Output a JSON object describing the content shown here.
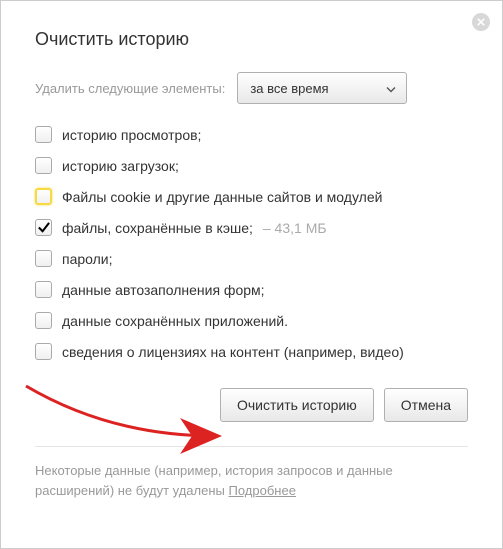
{
  "title": "Очистить историю",
  "time_range": {
    "label": "Удалить следующие элементы:",
    "selected": "за все время"
  },
  "options": [
    {
      "label": "историю просмотров;",
      "checked": false,
      "highlight": false,
      "extra": ""
    },
    {
      "label": "историю загрузок;",
      "checked": false,
      "highlight": false,
      "extra": ""
    },
    {
      "label": "Файлы cookie и другие данные сайтов и модулей",
      "checked": false,
      "highlight": true,
      "extra": ""
    },
    {
      "label": "файлы, сохранённые в кэше;",
      "checked": true,
      "highlight": false,
      "extra": "  –  43,1 МБ"
    },
    {
      "label": "пароли;",
      "checked": false,
      "highlight": false,
      "extra": ""
    },
    {
      "label": "данные автозаполнения форм;",
      "checked": false,
      "highlight": false,
      "extra": ""
    },
    {
      "label": "данные сохранённых приложений.",
      "checked": false,
      "highlight": false,
      "extra": ""
    },
    {
      "label": "сведения о лицензиях на контент (например, видео)",
      "checked": false,
      "highlight": false,
      "extra": ""
    }
  ],
  "buttons": {
    "clear": "Очистить историю",
    "cancel": "Отмена"
  },
  "footer": {
    "text": "Некоторые данные (например, история запросов и данные расширений) не будут удалены ",
    "link": "Подробнее"
  }
}
